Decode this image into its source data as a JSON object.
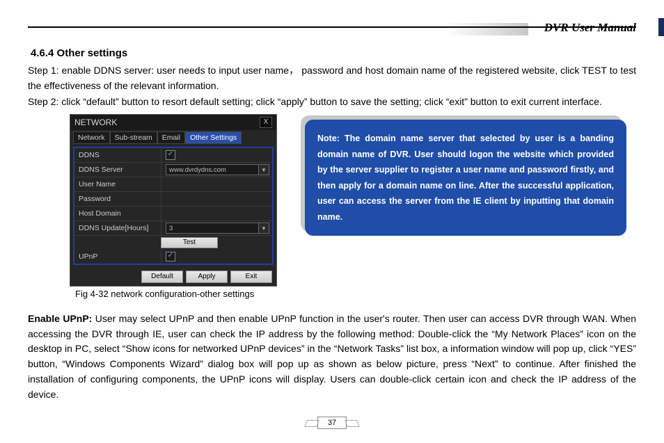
{
  "header": {
    "manual_title": "DVR User Manual"
  },
  "section": {
    "number_title": "4.6.4  Other settings",
    "step1": "Step 1: enable DDNS server: user needs to input user name， password and host domain name of the registered website, click TEST to test the effectiveness of the relevant information.",
    "step2": "Step 2: click “default” button to resort default setting; click “apply” button to save the setting; click “exit” button to exit current interface."
  },
  "figure": {
    "window_title": "NETWORK",
    "tabs": {
      "t1": "Network",
      "t2": "Sub-stream",
      "t3": "Email",
      "t4": "Other Settings"
    },
    "rows": {
      "ddns": "DDNS",
      "ddns_server": "DDNS Server",
      "ddns_server_val": "www.dvrdydns.com",
      "user_name": "User Name",
      "password": "Password",
      "host_domain": "Host Domain",
      "ddns_update": "DDNS Update[Hours]",
      "ddns_update_val": "3",
      "upnp": "UPnP"
    },
    "buttons": {
      "test": "Test",
      "def": "Default",
      "apply": "Apply",
      "exit": "Exit",
      "close": "X"
    },
    "caption": "Fig 4-32 network configuration-other settings"
  },
  "note": {
    "text": "Note: The domain name server that selected by user is a banding domain name of DVR. User should logon the website which provided by the server supplier to register a user name and password firstly, and then apply for a domain name on line. After the successful application, user can access the server from the IE client by inputting that domain name."
  },
  "lower": {
    "bold": "Enable UPnP: ",
    "text": "User may select UPnP and then enable UPnP function in the user's router. Then user can access DVR through WAN. When accessing the DVR through IE, user can check the IP address by the following method: Double-click the “My Network Places” icon on the desktop in PC, select “Show icons for networked UPnP devices” in the “Network Tasks” list box, a information window will pop up, click “YES” button, “Windows Components Wizard” dialog box will pop up as shown as below picture, press “Next” to continue. After finished the installation of configuring components, the UPnP icons will display. Users can double-click certain icon and check the IP address of the device."
  },
  "page_number": "37"
}
